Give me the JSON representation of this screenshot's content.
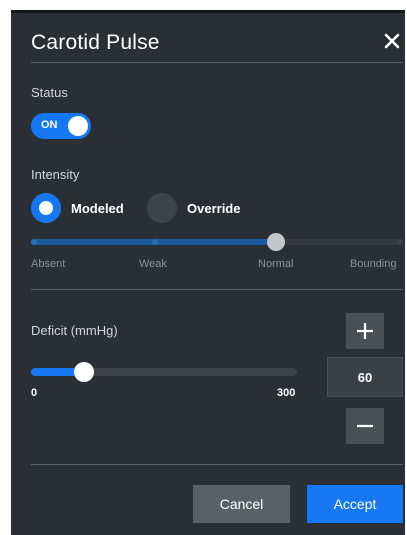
{
  "dialog": {
    "title": "Carotid Pulse"
  },
  "status": {
    "label": "Status",
    "toggle_text": "ON",
    "is_on": true
  },
  "intensity": {
    "label": "Intensity",
    "options": [
      {
        "label": "Modeled",
        "selected": true
      },
      {
        "label": "Override",
        "selected": false
      }
    ],
    "levels": [
      "Absent",
      "Weak",
      "Normal",
      "Bounding"
    ],
    "current_level": "Normal"
  },
  "deficit": {
    "label": "Deficit (mmHg)",
    "min_label": "0",
    "max_label": "300",
    "min": 0,
    "max": 300,
    "value": 60,
    "value_text": "60"
  },
  "buttons": {
    "cancel": "Cancel",
    "accept": "Accept"
  },
  "colors": {
    "accent": "#1677f2",
    "panel": "#2a2f35"
  },
  "icons": {
    "close": "close-icon",
    "plus": "plus-icon",
    "minus": "minus-icon"
  }
}
